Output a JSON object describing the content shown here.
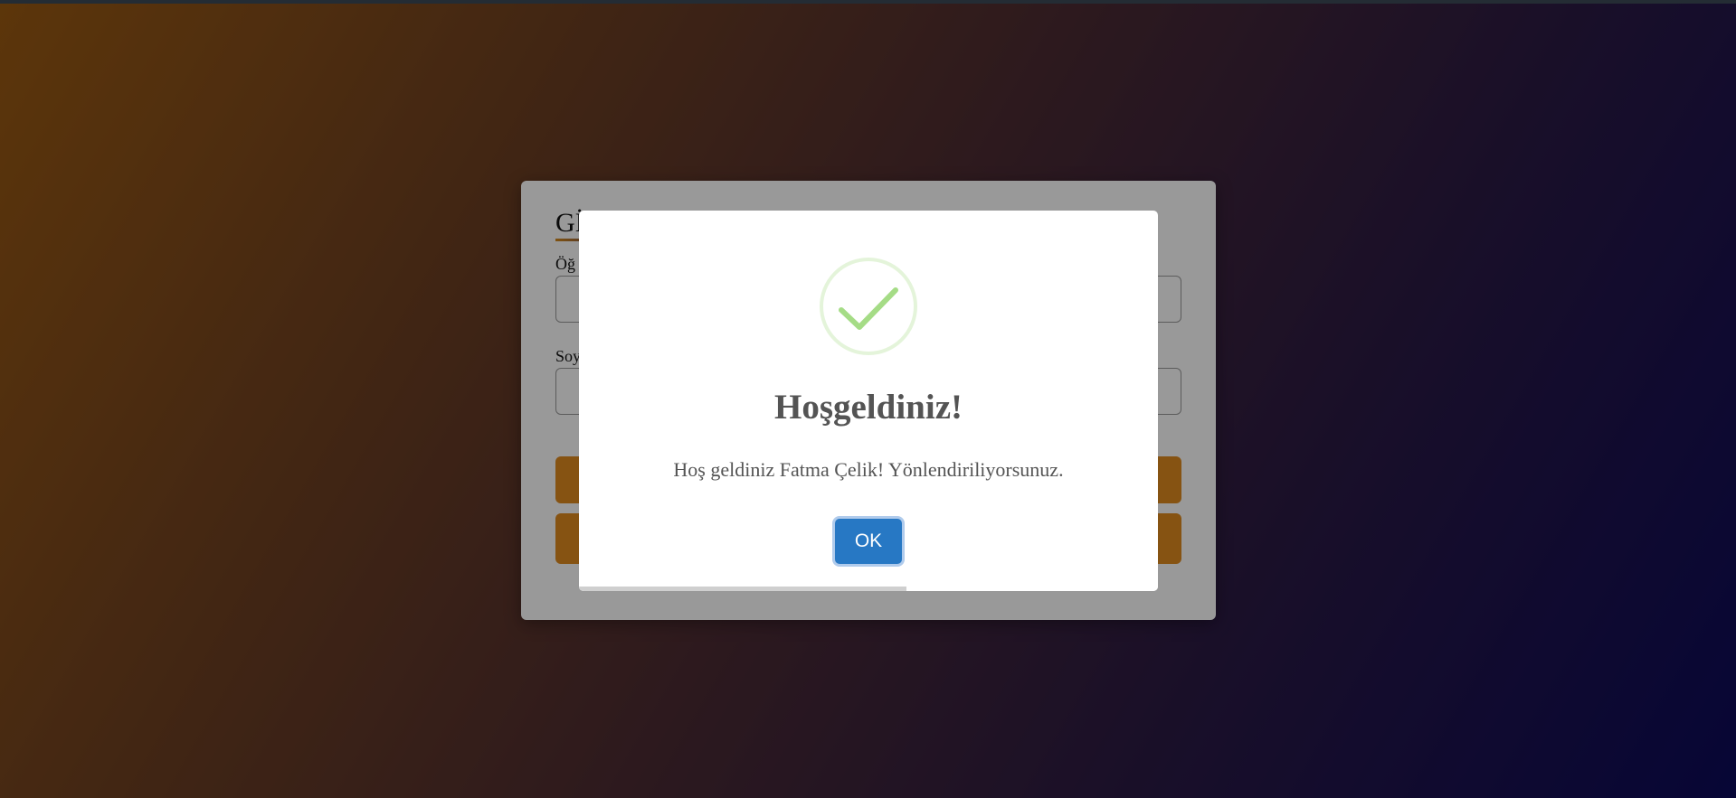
{
  "login_card": {
    "title": "Gİ",
    "label_student": "Öğ",
    "label_surname": "Soy",
    "input_student_value": "",
    "input_surname_value": "",
    "button_1_label": "",
    "button_2_label": ""
  },
  "modal": {
    "icon": "success-checkmark-icon",
    "title": "Hoşgeldiniz!",
    "text": "Hoş geldiniz Fatma Çelik! Yönlendiriliyorsunuz.",
    "ok_label": "OK",
    "timer_progress": 0.566
  },
  "colors": {
    "accent_button": "#2778c4",
    "success_green": "#a5dc86",
    "card_button": "#e08a1e"
  }
}
